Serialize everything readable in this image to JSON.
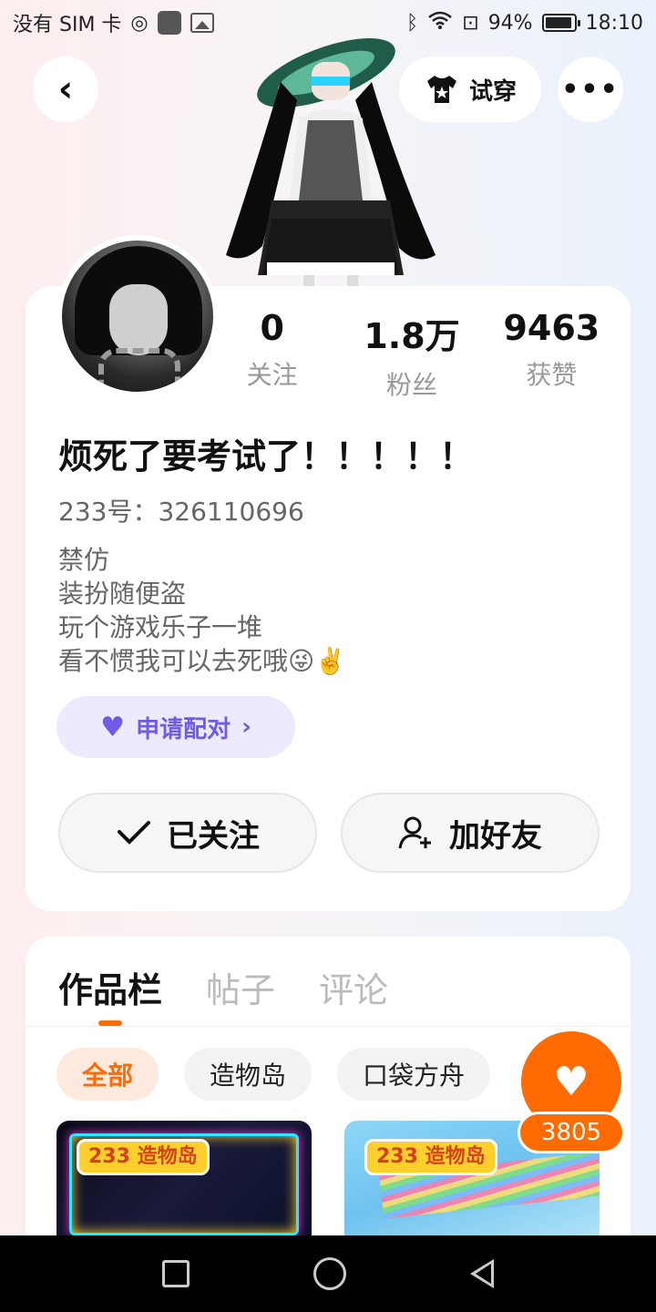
{
  "status_bar": {
    "carrier": "没有 SIM 卡",
    "battery_percent": "94%",
    "time": "18:10"
  },
  "top_bar": {
    "back_icon": "‹",
    "try_on_label": "试穿",
    "more_icon": "•••"
  },
  "profile": {
    "stats": [
      {
        "value": "0",
        "label": "关注"
      },
      {
        "value": "1.8万",
        "label": "粉丝"
      },
      {
        "value": "9463",
        "label": "获赞"
      }
    ],
    "nickname": "烦死了要考试了！！！！！",
    "id_line": "233号：326110696",
    "bio": [
      "禁仿",
      "装扮随便盗",
      "玩个游戏乐子一堆",
      "看不惯我可以去死哦😜✌️"
    ],
    "pair_button": "申请配对",
    "follow_button": "已关注",
    "add_friend_button": "加好友"
  },
  "works": {
    "tabs": [
      "作品栏",
      "帖子",
      "评论"
    ],
    "chips": [
      "全部",
      "造物岛",
      "口袋方舟"
    ],
    "thumbnails": [
      {
        "logo": "233 造物岛"
      },
      {
        "logo": "233 造物岛"
      }
    ]
  },
  "like": {
    "count": "3805"
  },
  "colors": {
    "accent": "#ff6b00",
    "pair_purple": "#6e5ce6"
  }
}
